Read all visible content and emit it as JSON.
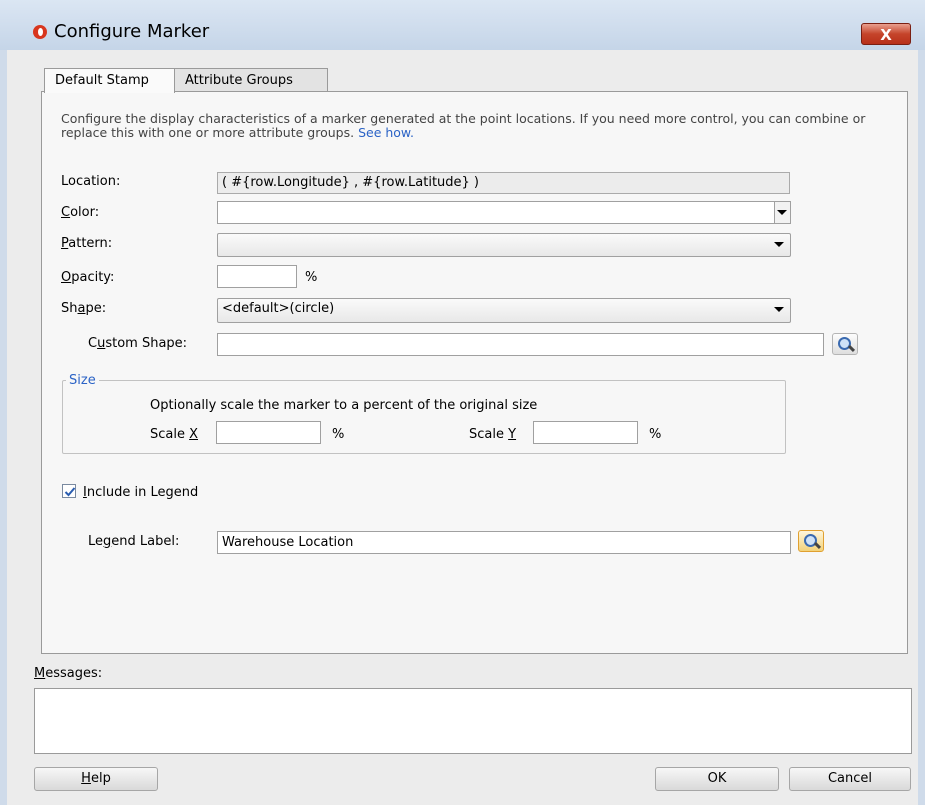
{
  "window": {
    "title": "Configure Marker",
    "close_glyph": "X"
  },
  "tabs": [
    {
      "label": "Default Stamp",
      "active": true
    },
    {
      "label": "Attribute Groups",
      "active": false
    }
  ],
  "description": {
    "text": "Configure the display characteristics of a marker generated at the point locations. If you need more control, you can combine or replace this with one or more attribute groups.",
    "link": "See how."
  },
  "form": {
    "location_label": "Location:",
    "location_value": "( #{row.Longitude} , #{row.Latitude} )",
    "color_label_u": "C",
    "color_label_rest": "olor:",
    "color_value": "",
    "pattern_label_u": "P",
    "pattern_label_rest": "attern:",
    "pattern_value": "",
    "opacity_label_u": "O",
    "opacity_label_rest": "pacity:",
    "opacity_value": "",
    "percent": "%",
    "shape_label_a": "Sh",
    "shape_label_u": "a",
    "shape_label_b": "pe:",
    "shape_value": "<default>(circle)",
    "custom_shape_label_a": "C",
    "custom_shape_label_u": "u",
    "custom_shape_label_b": "stom Shape:",
    "custom_shape_value": ""
  },
  "size_group": {
    "title": "Size",
    "hint": "Optionally scale the marker to a percent of the original size",
    "scale_x_label_a": "Scale ",
    "scale_x_label_u": "X",
    "scale_x_value": "",
    "scale_y_label_a": "Scale ",
    "scale_y_label_u": "Y",
    "scale_y_value": "",
    "percent": "%"
  },
  "legend": {
    "include_label_u": "I",
    "include_label_rest": "nclude in Legend",
    "include_checked": true,
    "label_a": "Le",
    "label_u": "g",
    "label_b": "end Label:",
    "value": "Warehouse Location"
  },
  "messages": {
    "label_u": "M",
    "label_rest": "essages:",
    "content": ""
  },
  "buttons": {
    "help_u": "H",
    "help_rest": "elp",
    "ok": "OK",
    "cancel": "Cancel"
  },
  "colors": {
    "link": "#2b63c6",
    "close_button": "#c5442a",
    "titlebar": "#c5d5e8",
    "app_icon": "#d8361e"
  },
  "icons": {
    "app": "oracle-logo-icon",
    "search": "magnifier-icon",
    "close": "close-icon"
  }
}
